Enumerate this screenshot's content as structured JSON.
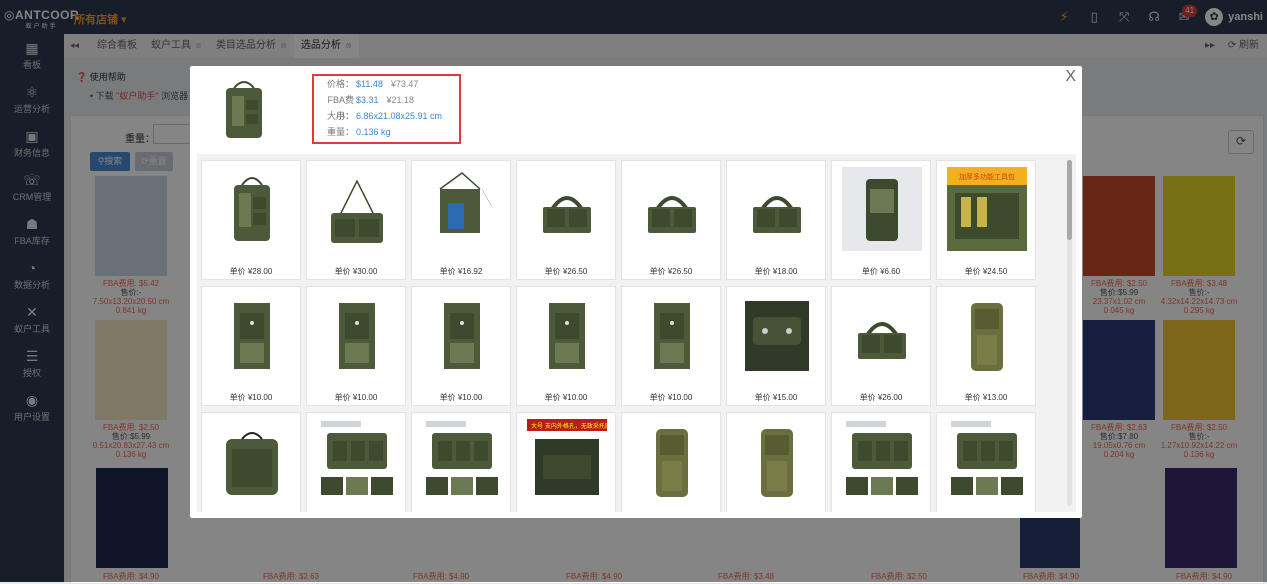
{
  "app": {
    "logo": "ANTCOOR",
    "logo_sub": "蚁户助手",
    "store_selector": "所有店铺 ▾",
    "user": "yanshi",
    "mail_badge": "41"
  },
  "sidebar": {
    "items": [
      {
        "label": "看板",
        "icon": "grid-icon"
      },
      {
        "label": "运营分析",
        "icon": "chart-icon"
      },
      {
        "label": "财务信息",
        "icon": "finance-icon"
      },
      {
        "label": "CRM管理",
        "icon": "crm-icon"
      },
      {
        "label": "FBA库存",
        "icon": "stock-icon"
      },
      {
        "label": "数据分析",
        "icon": "pie-icon"
      },
      {
        "label": "蚁户工具",
        "icon": "tools-icon"
      },
      {
        "label": "授权",
        "icon": "sliders-icon"
      },
      {
        "label": "用户设置",
        "icon": "user-icon"
      }
    ]
  },
  "tabs": [
    {
      "label": "综合看板",
      "closable": false
    },
    {
      "label": "蚁户工具",
      "closable": true
    },
    {
      "label": "类目选品分析",
      "closable": true
    },
    {
      "label": "选品分析",
      "closable": true
    }
  ],
  "tabbar_right": {
    "next": "▸▸",
    "refresh": "⟳ 刷新"
  },
  "help": {
    "title": "使用帮助",
    "line_prefix": "• 下载",
    "line_link": "\"蚁户助手\"",
    "line_suffix": "浏览器"
  },
  "filter": {
    "weight_label": "重量：",
    "search_button": "搜索",
    "reset_button": "重置"
  },
  "bg_cards": [
    {
      "fba": "FBA费用: $5.42",
      "price": "售价:-",
      "size": "7.50x13.20x20.50 cm",
      "weight": "0.841 kg"
    },
    {
      "fba": "FBA费用: $2.50",
      "price": "售价:$5.99",
      "size": "0.51x20.83x27.43 cm",
      "weight": "0.136 kg"
    },
    {
      "fba": "FBA费用: $2.50",
      "price": "售价:$5.99",
      "size": "23.37x1.02 cm",
      "weight": "0.045 kg"
    },
    {
      "fba": "FBA费用: $3.48",
      "price": "售价:-",
      "size": "4.32x14.22x14.73 cm",
      "weight": "0.295 kg"
    },
    {
      "fba": "FBA费用: $2.63",
      "price": "售价:$7.80",
      "size": "19.05x0.76 cm",
      "weight": "0.204 kg"
    },
    {
      "fba": "FBA费用: $2.50",
      "price": "售价:-",
      "size": "1.27x10.92x14.22 cm",
      "weight": "0.136 kg"
    }
  ],
  "bottom_fba": [
    "FBA费用: $4.90",
    "FBA费用: $2.63",
    "FBA费用: $4.90",
    "FBA费用: $4.90",
    "FBA费用: $3.48",
    "FBA费用: $2.50",
    "FBA费用: $4.90",
    "FBA费用: $4.90"
  ],
  "modal": {
    "close": "X",
    "info": [
      {
        "k": "价格：",
        "v": "$11.48",
        "v2": "¥73.47"
      },
      {
        "k": "FBA费用：",
        "v": "$3.31",
        "v2": "¥21.18"
      },
      {
        "k": "大小：",
        "v": "6.86x21.08x25.91 cm",
        "v2": ""
      },
      {
        "k": "重量：",
        "v": "0.136 kg",
        "v2": ""
      }
    ],
    "products": [
      {
        "price": "单价 ¥28.00",
        "style": "tablet"
      },
      {
        "price": "单价 ¥30.00",
        "style": "sling"
      },
      {
        "price": "单价 ¥16.92",
        "style": "phone"
      },
      {
        "price": "单价 ¥26.50",
        "style": "messenger"
      },
      {
        "price": "单价 ¥26.50",
        "style": "messenger"
      },
      {
        "price": "单价 ¥18.00",
        "style": "messenger"
      },
      {
        "price": "单价 ¥6.60",
        "style": "pouch"
      },
      {
        "price": "单价 ¥24.50",
        "style": "banner"
      },
      {
        "price": "单价 ¥10.00",
        "style": "neck"
      },
      {
        "price": "单价 ¥10.00",
        "style": "neck"
      },
      {
        "price": "单价 ¥10.00",
        "style": "neck"
      },
      {
        "price": "单价 ¥10.00",
        "style": "neck"
      },
      {
        "price": "单价 ¥10.00",
        "style": "neck"
      },
      {
        "price": "单价 ¥15.00",
        "style": "darkbag"
      },
      {
        "price": "单价 ¥26.00",
        "style": "messenger"
      },
      {
        "price": "单价 ¥13.00",
        "style": "pouch2"
      },
      {
        "price": "",
        "style": "shoulder"
      },
      {
        "price": "",
        "style": "multi"
      },
      {
        "price": "",
        "style": "multi"
      },
      {
        "price": "",
        "style": "redlabel"
      },
      {
        "price": "",
        "style": "pouch2"
      },
      {
        "price": "",
        "style": "pouch2"
      },
      {
        "price": "",
        "style": "multi"
      },
      {
        "price": "",
        "style": "multi"
      }
    ],
    "banner_text": "加厚多功能工具包",
    "redlabel_text": "大号   支内外格孔，无政采托底"
  },
  "colors": {
    "topbar": "#2c3b4f",
    "accent_orange": "#f0a030",
    "link_blue": "#3b86d6",
    "highlight_red": "#e4393c",
    "olive": "#4d5a3a"
  }
}
